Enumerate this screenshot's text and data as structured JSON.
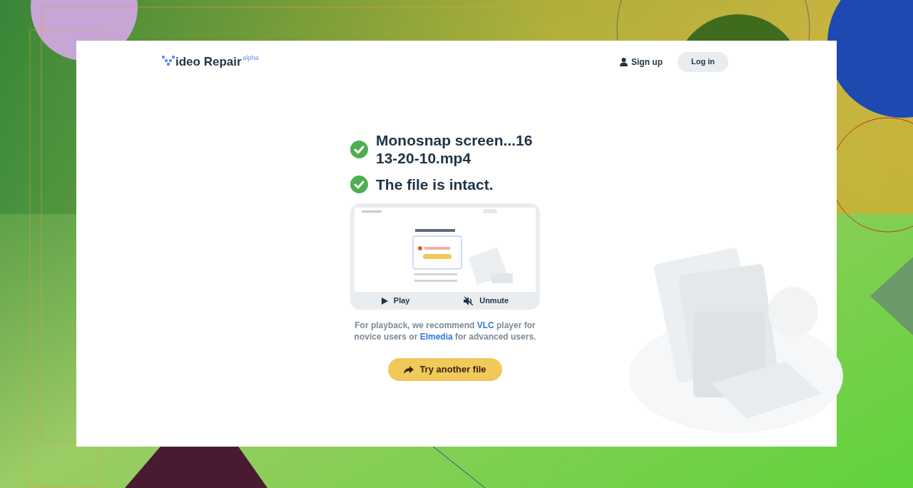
{
  "header": {
    "logo": {
      "text": "ideo Repair",
      "badge": "alpha"
    },
    "signup": "Sign up",
    "login": "Log in"
  },
  "results": [
    {
      "text": "Monosnap screen...16 13-20-10.mp4",
      "checked": true
    },
    {
      "text": "The file is intact.",
      "checked": true
    }
  ],
  "player": {
    "play": "Play",
    "unmute": "Unmute",
    "muted": true
  },
  "note": [
    {
      "kind": "text",
      "text": "For playback, we recommend "
    },
    {
      "kind": "link",
      "text": "VLC"
    },
    {
      "kind": "text",
      "text": " player for novice users or "
    },
    {
      "kind": "link",
      "text": "Elmedia"
    },
    {
      "kind": "text",
      "text": " for advanced users."
    }
  ],
  "action": "Try another file"
}
